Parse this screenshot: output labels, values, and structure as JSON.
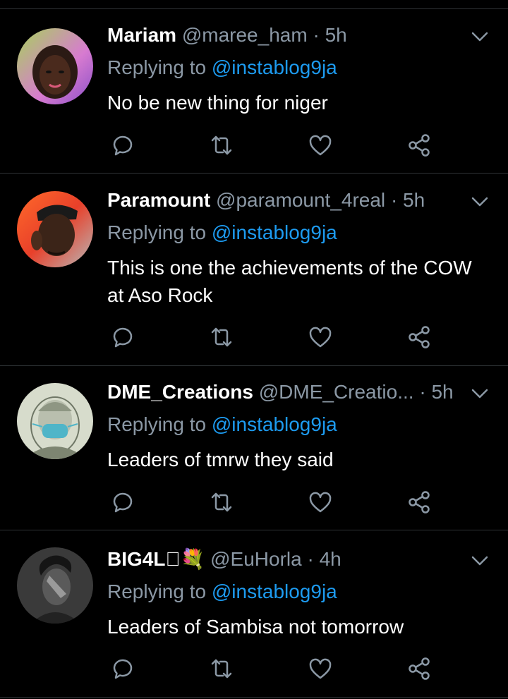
{
  "colors": {
    "background": "#000000",
    "name": "#ffffff",
    "muted": "#8b98a5",
    "link": "#1d9bf0",
    "separator": "#2f3336"
  },
  "icons": {
    "reply": "comment-icon",
    "retweet": "retweet-icon",
    "like": "heart-icon",
    "share": "share-icon",
    "more": "chevron-down-icon"
  },
  "tweets": [
    {
      "name": "Mariam",
      "handle": "@maree_ham",
      "dot": "·",
      "time": "5h",
      "replying_prefix": "Replying to",
      "replying_to": "@instablog9ja",
      "text": "No be new thing for niger"
    },
    {
      "name": "Paramount",
      "handle": "@paramount_4real",
      "dot": "·",
      "time": "5h",
      "replying_prefix": "Replying to",
      "replying_to": "@instablog9ja",
      "text": "This is one the achievements of the COW at Aso Rock"
    },
    {
      "name": "DME_Creations",
      "handle": "@DME_Creatio...",
      "dot": "·",
      "time": "5h",
      "replying_prefix": "Replying to",
      "replying_to": "@instablog9ja",
      "text": "Leaders of tmrw they said"
    },
    {
      "name": "BIG4L🏻💐",
      "handle": "@EuHorla",
      "dot": "·",
      "time": "4h",
      "replying_prefix": "Replying to",
      "replying_to": "@instablog9ja",
      "text": "Leaders of Sambisa not tomorrow"
    }
  ]
}
